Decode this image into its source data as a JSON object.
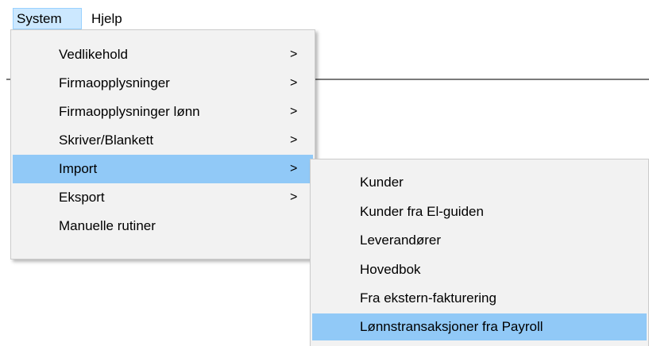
{
  "menubar": {
    "system_label": "System",
    "hjelp_label": "Hjelp"
  },
  "main_menu": {
    "items": [
      {
        "label": "Vedlikehold",
        "arrow": ">"
      },
      {
        "label": "Firmaopplysninger",
        "arrow": ">"
      },
      {
        "label": "Firmaopplysninger lønn",
        "arrow": ">"
      },
      {
        "label": "Skriver/Blankett",
        "arrow": ">"
      },
      {
        "label": "Import",
        "arrow": ">"
      },
      {
        "label": "Eksport",
        "arrow": ">"
      },
      {
        "label": "Manuelle rutiner"
      }
    ]
  },
  "import_submenu": {
    "items": [
      {
        "label": "Kunder"
      },
      {
        "label": "Kunder fra El-guiden"
      },
      {
        "label": "Leverandører"
      },
      {
        "label": "Hovedbok"
      },
      {
        "label": "Fra ekstern-fakturering"
      },
      {
        "label": "Lønnstransaksjoner fra Payroll"
      }
    ]
  },
  "colors": {
    "menu_background": "#f2f2f2",
    "highlight": "#91c9f7",
    "menubar_active": "#cce8ff"
  }
}
